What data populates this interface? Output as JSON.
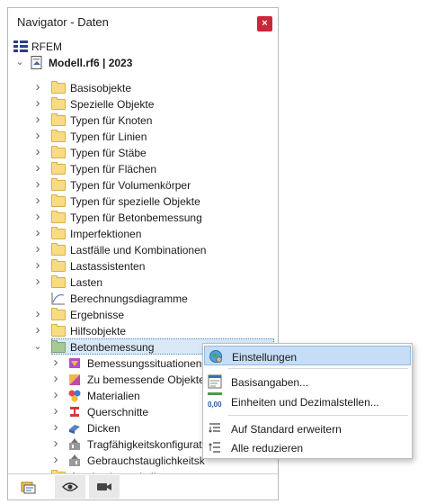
{
  "window": {
    "title": "Navigator - Daten",
    "close_glyph": "×"
  },
  "tree": {
    "root": {
      "label": "RFEM"
    },
    "model": {
      "label": "Modell.rf6 | 2023"
    },
    "items": [
      {
        "label": "Basisobjekte"
      },
      {
        "label": "Spezielle Objekte"
      },
      {
        "label": "Typen für Knoten"
      },
      {
        "label": "Typen für Linien"
      },
      {
        "label": "Typen für Stäbe"
      },
      {
        "label": "Typen für Flächen"
      },
      {
        "label": "Typen für Volumenkörper"
      },
      {
        "label": "Typen für spezielle Objekte"
      },
      {
        "label": "Typen für Betonbemessung"
      },
      {
        "label": "Imperfektionen"
      },
      {
        "label": "Lastfälle und Kombinationen"
      },
      {
        "label": "Lastassistenten"
      },
      {
        "label": "Lasten"
      },
      {
        "label": "Berechnungsdiagramme"
      },
      {
        "label": "Ergebnisse"
      },
      {
        "label": "Hilfsobjekte"
      },
      {
        "label": "Betonbemessung"
      }
    ],
    "children": [
      {
        "label": "Bemessungssituationen"
      },
      {
        "label": "Zu bemessende Objekte"
      },
      {
        "label": "Materialien"
      },
      {
        "label": "Querschnitte"
      },
      {
        "label": "Dicken"
      },
      {
        "label": "Tragfähigkeitskonfigurat"
      },
      {
        "label": "Gebrauchstauglichkeitsk"
      }
    ],
    "last": {
      "label": "Ausdruckprotokolle"
    }
  },
  "context_menu": {
    "items": [
      {
        "label": "Einstellungen",
        "icon": "globe-gear-icon"
      },
      {
        "label": "Basisangaben...",
        "icon": "form-icon"
      },
      {
        "label": "Einheiten und Dezimalstellen...",
        "icon": "units-icon",
        "icon_text": "0,00"
      },
      {
        "label": "Auf Standard erweitern",
        "icon": "expand-icon"
      },
      {
        "label": "Alle reduzieren",
        "icon": "collapse-icon"
      }
    ]
  },
  "colors": {
    "accent": "#5b8dc6",
    "close": "#c8293a",
    "folder": "#f8dc82",
    "open_folder": "#a7c997"
  }
}
